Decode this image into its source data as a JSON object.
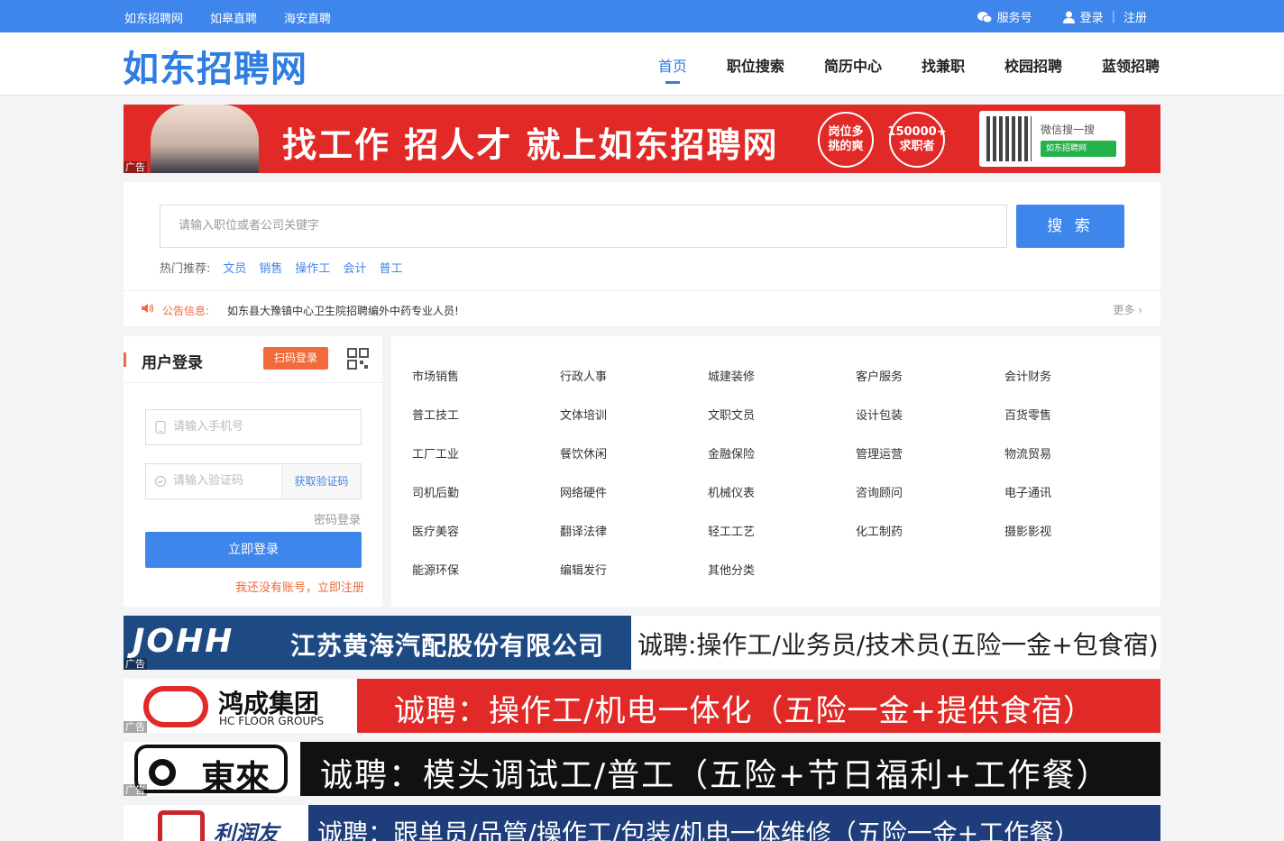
{
  "topbar": {
    "links": [
      "如东招聘网",
      "如皋直聘",
      "海安直聘"
    ],
    "service": "服务号",
    "login": "登录",
    "register": "注册"
  },
  "header": {
    "logo": "如东招聘网",
    "nav": [
      "首页",
      "职位搜索",
      "简历中心",
      "找兼职",
      "校园招聘",
      "蓝领招聘"
    ],
    "active_index": 0
  },
  "top_ad": {
    "slogan": "找工作 招人才 就上如东招聘网",
    "badge1": [
      "岗位多",
      "挑的爽"
    ],
    "badge2": [
      "150000+",
      "求职者"
    ],
    "wechat": "微信搜一搜",
    "wechat_btn": "如东招聘网",
    "tag": "广告"
  },
  "search": {
    "placeholder": "请输入职位或者公司关键字",
    "button": "搜 索",
    "hot_label": "热门推荐:",
    "hot": [
      "文员",
      "销售",
      "操作工",
      "会计",
      "普工"
    ]
  },
  "notice": {
    "label": "公告信息:",
    "text": "如东县大豫镇中心卫生院招聘编外中药专业人员!",
    "more": "更多 ›"
  },
  "login": {
    "title": "用户登录",
    "scan": "扫码登录",
    "phone_placeholder": "请输入手机号",
    "code_placeholder": "请输入验证码",
    "get_code": "获取验证码",
    "password_login": "密码登录",
    "submit": "立即登录",
    "register": "我还没有账号，立即注册"
  },
  "categories": [
    [
      "市场销售",
      "行政人事",
      "城建装修",
      "客户服务",
      "会计财务"
    ],
    [
      "普工技工",
      "文体培训",
      "文职文员",
      "设计包装",
      "百货零售"
    ],
    [
      "工厂工业",
      "餐饮休闲",
      "金融保险",
      "管理运营",
      "物流贸易"
    ],
    [
      "司机后勤",
      "网络硬件",
      "机械仪表",
      "咨询顾问",
      "电子通讯"
    ],
    [
      "医疗美容",
      "翻译法律",
      "轻工工艺",
      "化工制药",
      "摄影影视"
    ],
    [
      "能源环保",
      "编辑发行",
      "其他分类"
    ]
  ],
  "ads": [
    {
      "brand": "JOHH",
      "company": "江苏黄海汽配股份有限公司",
      "text": "诚聘:操作工/业务员/技术员(五险一金+包食宿)",
      "tag": "广告"
    },
    {
      "brand": "鸿成集团",
      "sub": "HC FLOOR GROUPS",
      "text": "诚聘：操作工/机电一体化（五险一金+提供食宿）",
      "tag": "广告"
    },
    {
      "brand": "東來",
      "text": "诚聘：模头调试工/普工（五险+节日福利+工作餐）",
      "tag": "广告"
    },
    {
      "brand": "利润友",
      "text": "诚聘：跟单员/品管/操作工/包装/机电一体维修（五险一金+工作餐）"
    }
  ],
  "colors": {
    "primary": "#3f86ec",
    "accent": "#f06a3a",
    "ad_red": "#e12a27"
  }
}
